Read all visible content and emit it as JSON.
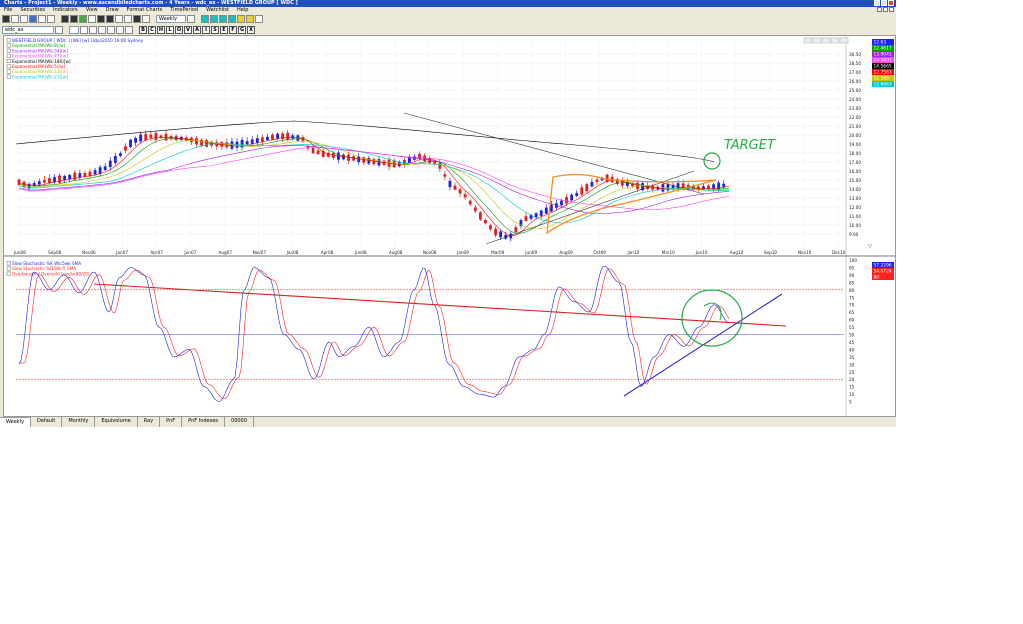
{
  "window": {
    "title": "Charts - Project1 - Weekly - www.ascendbiledcharts.com - 4 Years - wdc_ax - WESTFIELD GROUP [ WDC ]"
  },
  "menu": [
    "File",
    "Securities",
    "Indicators",
    "View",
    "Draw",
    "Format Charts",
    "TimePeriod",
    "Watchlist",
    "Help"
  ],
  "toolbar": {
    "period": "Weekly",
    "symbol": "wdc_ax",
    "letter_buttons": [
      "B",
      "C",
      "H",
      "L",
      "O",
      "V",
      "A",
      "I",
      "S",
      "E",
      "F",
      "G",
      "X"
    ]
  },
  "price_panel": {
    "legend": [
      {
        "label": "WESTFIELD GROUP [ WDC ] [Wk] [w]  18Jun2010  19:00  Sydney",
        "color": "#1a1aff"
      },
      {
        "label": "Exponential MA(Wk:8)[w]",
        "color": "#00a000"
      },
      {
        "label": "Exponential MA(Wk:34)[w]",
        "color": "#a020f0"
      },
      {
        "label": "Exponential MA(Wk:41)[w]",
        "color": "#ff40ff"
      },
      {
        "label": "Exponential MA(Wk:186)[w]",
        "color": "#000000"
      },
      {
        "label": "Exponential MA(Wk:5)[w]",
        "color": "#ff0000"
      },
      {
        "label": "Exponential MA(Wk:13)[w]",
        "color": "#c8c800"
      },
      {
        "label": "Exponential MA(Wk:21)[w]",
        "color": "#00c8c8"
      }
    ],
    "value_boxes": [
      {
        "value": "12.63",
        "color": "#2020ff"
      },
      {
        "value": "12.4617",
        "color": "#00a000"
      },
      {
        "value": "13.9041",
        "color": "#a020f0"
      },
      {
        "value": "14.0401",
        "color": "#ff40ff"
      },
      {
        "value": "14.5665",
        "color": "#000000"
      },
      {
        "value": "12.7563",
        "color": "#ff0000"
      },
      {
        "value": "12.585",
        "color": "#c8c800"
      },
      {
        "value": "12.6663",
        "color": "#00c8c8"
      }
    ],
    "y_ticks": [
      "30.50",
      "28.50",
      "27.00",
      "26.00",
      "25.00",
      "24.00",
      "23.00",
      "22.00",
      "21.00",
      "20.00",
      "19.00",
      "18.00",
      "17.00",
      "16.00",
      "15.00",
      "14.00",
      "13.00",
      "12.00",
      "11.00",
      "10.00",
      "9.00"
    ],
    "x_ticks": [
      "Jun06",
      "Sep06",
      "Nov06",
      "Jan07",
      "Apr07",
      "Jun07",
      "Aug07",
      "Nov07",
      "Jan08",
      "Apr08",
      "Jun08",
      "Aug08",
      "Nov08",
      "Jan09",
      "Mar09",
      "Jun09",
      "Aug09",
      "Oct09",
      "Jan10",
      "Mar10",
      "Jun10",
      "Aug10",
      "Sep10",
      "Nov10",
      "Dec10"
    ],
    "annotation": "TARGET"
  },
  "osc_panel": {
    "legend": [
      {
        "label": "Slow Stochastic %K Wk:5wk SMA",
        "color": "#1a1aff"
      },
      {
        "label": "Slow Stochastic %D(Wk:5 SMA",
        "color": "#ff2020"
      },
      {
        "label": "Overbought / Oversold Levels(80/20)",
        "color": "#ff2020"
      }
    ],
    "value_boxes": [
      {
        "value": "57.2296",
        "color": "#2020ff"
      },
      {
        "value": "54.0724",
        "color": "#ff2020"
      },
      {
        "value": "80",
        "color": "#ff2020"
      }
    ],
    "y_ticks": [
      "100",
      "95",
      "90",
      "85",
      "80",
      "75",
      "70",
      "65",
      "60",
      "55",
      "50",
      "45",
      "40",
      "35",
      "30",
      "25",
      "20",
      "15",
      "10",
      "5"
    ]
  },
  "tabs": [
    "Weekly",
    "Default",
    "Monthly",
    "Equivolume",
    "Ray",
    "PnF",
    "PnF Indexes",
    "00000"
  ],
  "colors": {
    "up_bar": "#2020e0",
    "down_bar": "#e02020",
    "orange_draw": "#ff8c1a",
    "green_draw": "#22aa44",
    "trend_red": "#dd1f1f",
    "trend_blue": "#2a2ad0"
  }
}
